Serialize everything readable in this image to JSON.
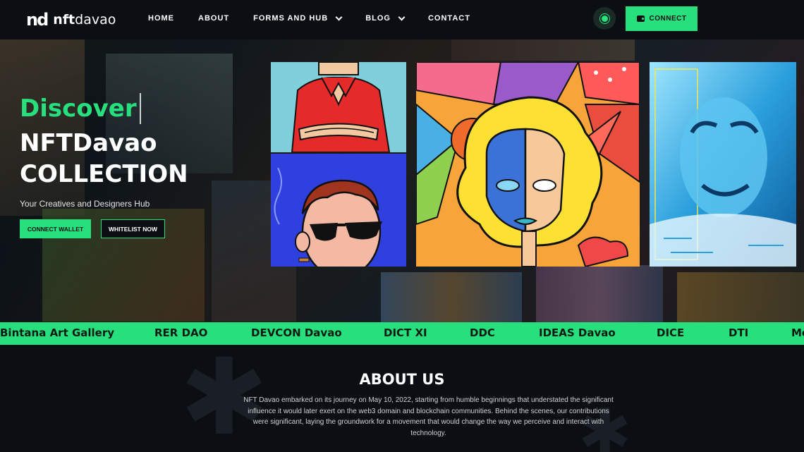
{
  "brand": {
    "mark": "nd",
    "name_bold": "nft",
    "name_rest": "davao"
  },
  "nav": {
    "items": [
      {
        "label": "HOME",
        "dropdown": false
      },
      {
        "label": "ABOUT",
        "dropdown": false
      },
      {
        "label": "FORMS AND HUB",
        "dropdown": true
      },
      {
        "label": "BLOG",
        "dropdown": true
      },
      {
        "label": "CONTACT",
        "dropdown": false
      }
    ],
    "theme_icon": "sun-icon",
    "connect_label": "CONNECT"
  },
  "hero": {
    "discover": "Discover",
    "line1": "NFTDavao",
    "line2": "COLLECTION",
    "subtitle": "Your Creatives and Designers Hub",
    "btn_connect_wallet": "CONNECT WALLET",
    "btn_whitelist": "WHITELIST NOW"
  },
  "partners": [
    "Bintana Art Gallery",
    "RER DAO",
    "DEVCON Davao",
    "DICT XI",
    "DDC",
    "IDEAS Davao",
    "DICE",
    "DTI",
    "Me"
  ],
  "about": {
    "title": "ABOUT US",
    "text": "NFT Davao embarked on its journey on May 10, 2022, starting from humble beginnings that understated the significant influence it would later exert on the web3 domain and blockchain communities. Behind the scenes, our contributions were significant, laying the groundwork for a movement that would change the way we perceive and interact with technology."
  },
  "colors": {
    "accent": "#27e07d",
    "background": "#0b0f14"
  }
}
